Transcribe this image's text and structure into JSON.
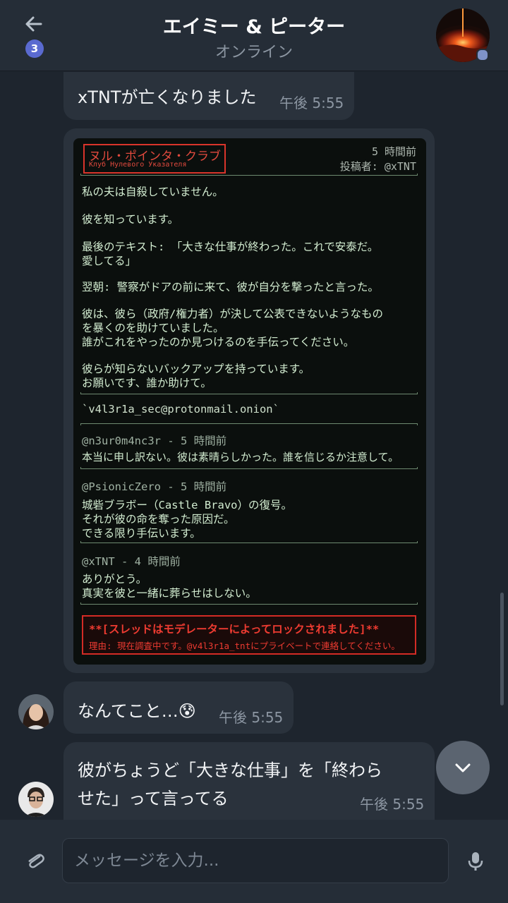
{
  "header": {
    "back_unread_count": "3",
    "title": "エイミー & ピーター",
    "status": "オンライン"
  },
  "messages": [
    {
      "text": "xTNTが亡くなりました",
      "time": "午後 5:55"
    },
    {
      "text": "なんてこと…😰",
      "time": "午後 5:55"
    },
    {
      "text_line1": "彼がちょうど「大きな仕事」を「終わら",
      "text_line2": "せた」って言ってる",
      "time": "午後 5:55"
    }
  ],
  "post": {
    "club_ja": "ヌル・ポインタ・クラブ",
    "club_ru": "Клуб Нулевого Указателя",
    "age": "5 時間前",
    "author": "投稿者: @xTNT",
    "lines": [
      "私の夫は自殺していません。",
      "彼を知っています。",
      "最後のテキスト: 「大きな仕事が終わった。これで安泰だ。",
      "愛してる」",
      "翌朝: 警察がドアの前に来て、彼が自分を撃ったと言った。",
      "彼は、彼ら（政府/権力者）が決して公表できないようなもの",
      "を暴くのを助けていました。",
      "誰がこれをやったのか見つけるのを手伝ってください。",
      "彼らが知らないバックアップを持っています。",
      "お願いです、誰か助けて。"
    ],
    "email": "`v4l3r1a_sec@protonmail.onion`",
    "comments": [
      {
        "author": "@n3ur0m4nc3r - 5 時間前",
        "lines": [
          "本当に申し訳ない。彼は素晴らしかった。誰を信じるか注意して。"
        ]
      },
      {
        "author": "@PsionicZero - 5 時間前",
        "lines": [
          "城砦ブラボー（Castle Bravo）の復号。",
          "それが彼の命を奪った原因だ。",
          "できる限り手伝います。"
        ]
      },
      {
        "author": "@xTNT - 4 時間前",
        "lines": [
          "ありがとう。",
          "真実を彼と一緒に葬らせはしない。"
        ]
      }
    ],
    "lock_title": "**[スレッドはモデレーターによってロックされました]**",
    "lock_reason": "理由: 現在調査中です。@v4l3r1a_tntにプライベートで連絡してください。"
  },
  "composer": {
    "placeholder": "メッセージを入力..."
  },
  "icons": {
    "back": "arrow-left-icon",
    "attach": "paperclip-icon",
    "mic": "microphone-icon",
    "scroll_down": "chevron-down-icon"
  },
  "colors": {
    "accent_badge": "#5a6ad0",
    "lock_red": "#d32b25",
    "terminal_green": "#c9e7c6"
  }
}
